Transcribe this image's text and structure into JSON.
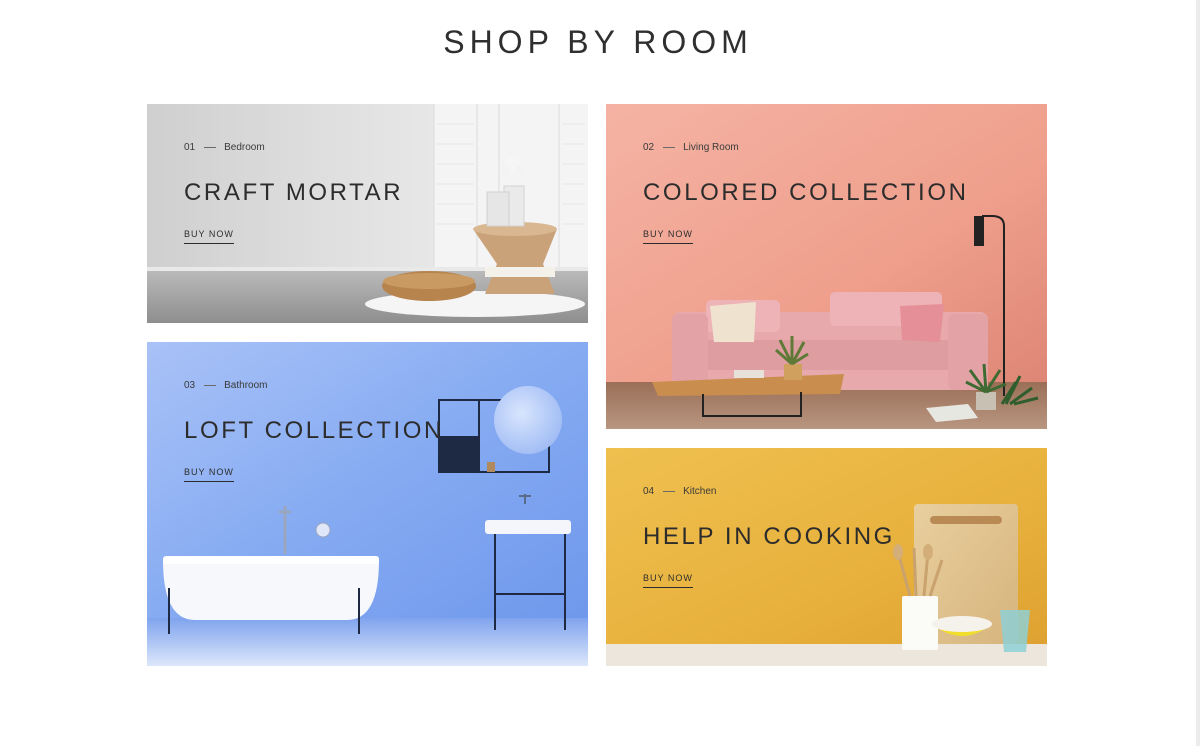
{
  "page": {
    "title": "SHOP BY ROOM"
  },
  "rooms": [
    {
      "number": "01",
      "category": "Bedroom",
      "title": "CRAFT MORTAR",
      "cta": "BUY NOW",
      "bg": "#d8d8d8"
    },
    {
      "number": "02",
      "category": "Living Room",
      "title": "COLORED COLLECTION",
      "cta": "BUY NOW",
      "bg": "#f0a596"
    },
    {
      "number": "03",
      "category": "Bathroom",
      "title": "LOFT COLLECTION",
      "cta": "BUY NOW",
      "bg": "#86abf2"
    },
    {
      "number": "04",
      "category": "Kitchen",
      "title": "HELP IN COOKING",
      "cta": "BUY NOW",
      "bg": "#eab53f"
    }
  ]
}
